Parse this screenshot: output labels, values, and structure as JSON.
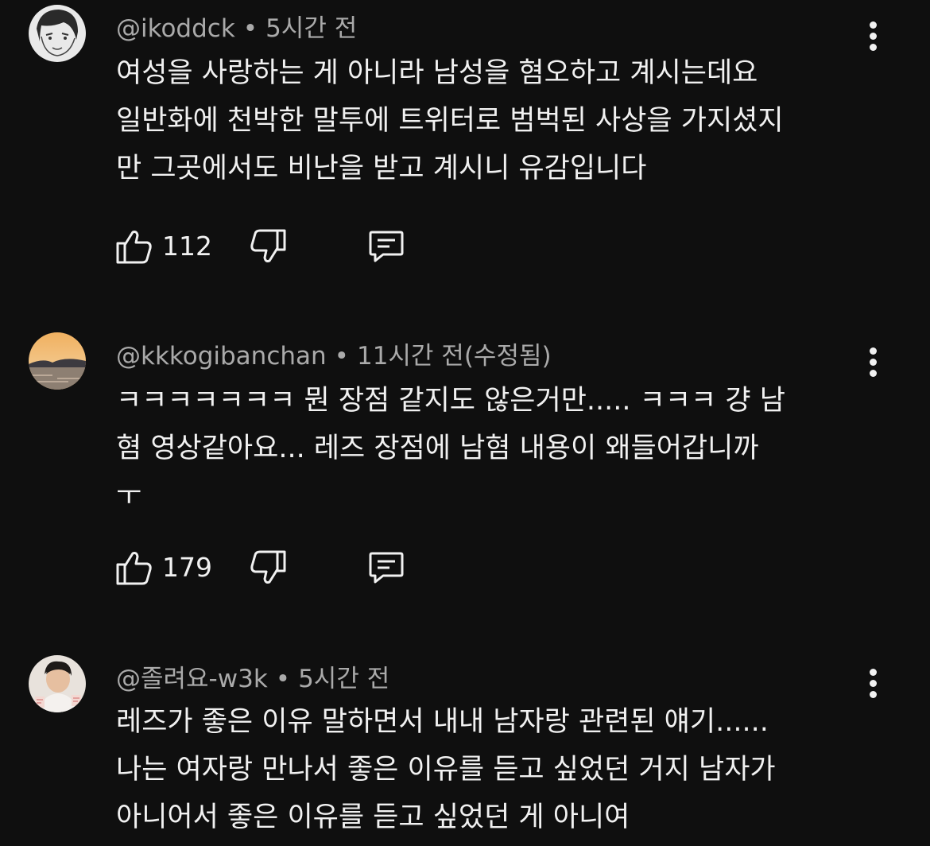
{
  "comments": [
    {
      "author": "@ikoddck",
      "time": "5시간 전",
      "lines": [
        "여성을 사랑하는 게 아니라 남성을 혐오하고 계시는데요",
        "일반화에 천박한 말투에 트위터로 범벅된 사상을 가지셨지",
        "만 그곳에서도 비난을 받고 계시니 유감입니다"
      ],
      "likes": "112"
    },
    {
      "author": "@kkkogibanchan",
      "time": "11시간 전(수정됨)",
      "lines": [
        "ㅋㅋㅋㅋㅋㅋㅋ 뭔 장점 같지도 않은거만.....  ㅋㅋㅋ 걍 남",
        "혐 영상같아요... 레즈 장점에 남혐 내용이 왜들어갑니까",
        "ㅜ"
      ],
      "likes": "179"
    },
    {
      "author": "@졸려요-w3k",
      "time": "5시간 전",
      "lines": [
        "레즈가 좋은 이유 말하면서 내내 남자랑 관련된 얘기......",
        "나는 여자랑 만나서 좋은 이유를 듣고 싶었던 거지 남자가",
        "아니어서 좋은 이유를 듣고 싶었던 게 아니여"
      ],
      "likes": ""
    }
  ],
  "separator": "•",
  "icons": {
    "like": "thumbs-up-icon",
    "dislike": "thumbs-down-icon",
    "reply": "reply-icon",
    "more": "more-vertical-icon"
  },
  "colors": {
    "background": "#0f0f0f",
    "text": "#f1f1f1",
    "meta": "#aaaaaa"
  }
}
